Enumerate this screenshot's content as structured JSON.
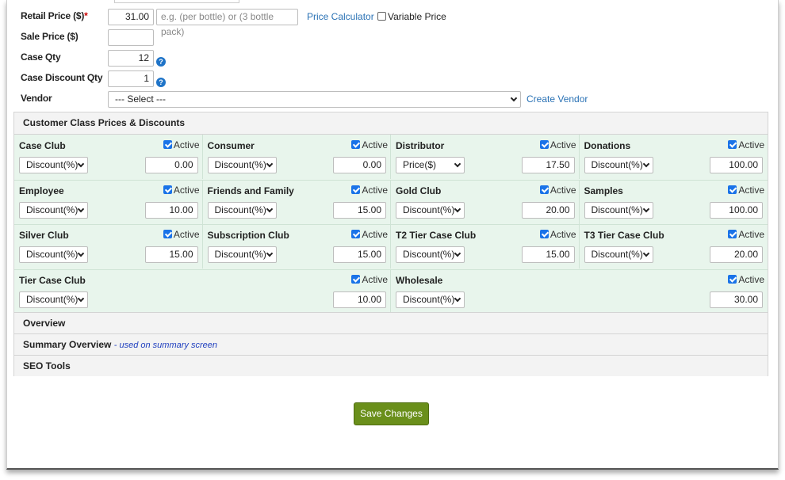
{
  "form": {
    "retail_price_label": "Retail Price ($)",
    "retail_price_required": "*",
    "retail_price_value": "31.00",
    "retail_price_hint": "e.g. (per bottle) or (3 bottle pack)",
    "price_calculator_link": "Price Calculator",
    "variable_price_label": "Variable Price",
    "sale_price_label": "Sale Price ($)",
    "sale_price_value": "",
    "case_qty_label": "Case Qty",
    "case_qty_value": "12",
    "case_discount_qty_label": "Case Discount Qty",
    "case_discount_qty_value": "1",
    "vendor_label": "Vendor",
    "vendor_selected": "--- Select ---",
    "create_vendor_link": "Create Vendor",
    "help_icon": "question-icon"
  },
  "customer_classes": {
    "title": "Customer Class Prices & Discounts",
    "active_label": "Active",
    "items": [
      {
        "name": "Case Club",
        "type": "Discount(%)",
        "value": "0.00",
        "active": true
      },
      {
        "name": "Consumer",
        "type": "Discount(%)",
        "value": "0.00",
        "active": true
      },
      {
        "name": "Distributor",
        "type": "Price($)",
        "value": "17.50",
        "active": true
      },
      {
        "name": "Donations",
        "type": "Discount(%)",
        "value": "100.00",
        "active": true
      },
      {
        "name": "Employee",
        "type": "Discount(%)",
        "value": "10.00",
        "active": true
      },
      {
        "name": "Friends and Family",
        "type": "Discount(%)",
        "value": "15.00",
        "active": true
      },
      {
        "name": "Gold Club",
        "type": "Discount(%)",
        "value": "20.00",
        "active": true
      },
      {
        "name": "Samples",
        "type": "Discount(%)",
        "value": "100.00",
        "active": true
      },
      {
        "name": "Silver Club",
        "type": "Discount(%)",
        "value": "15.00",
        "active": true
      },
      {
        "name": "Subscription Club",
        "type": "Discount(%)",
        "value": "15.00",
        "active": true
      },
      {
        "name": "T2 Tier Case Club",
        "type": "Discount(%)",
        "value": "15.00",
        "active": true
      },
      {
        "name": "T3 Tier Case Club",
        "type": "Discount(%)",
        "value": "20.00",
        "active": true
      },
      {
        "name": "Tier Case Club",
        "type": "Discount(%)",
        "value": "10.00",
        "active": true
      },
      {
        "name": "Wholesale",
        "type": "Discount(%)",
        "value": "30.00",
        "active": true
      }
    ]
  },
  "sections": {
    "overview": "Overview",
    "summary_overview": "Summary Overview",
    "summary_overview_note": "- used on summary screen",
    "seo_tools": "SEO Tools"
  },
  "actions": {
    "save_label": "Save Changes"
  },
  "colors": {
    "link": "#2a72b5",
    "save_button": "#6a8f1b",
    "grid_background": "#e8f5ec",
    "checkbox": "#1a73e8",
    "required": "#cc0000"
  }
}
